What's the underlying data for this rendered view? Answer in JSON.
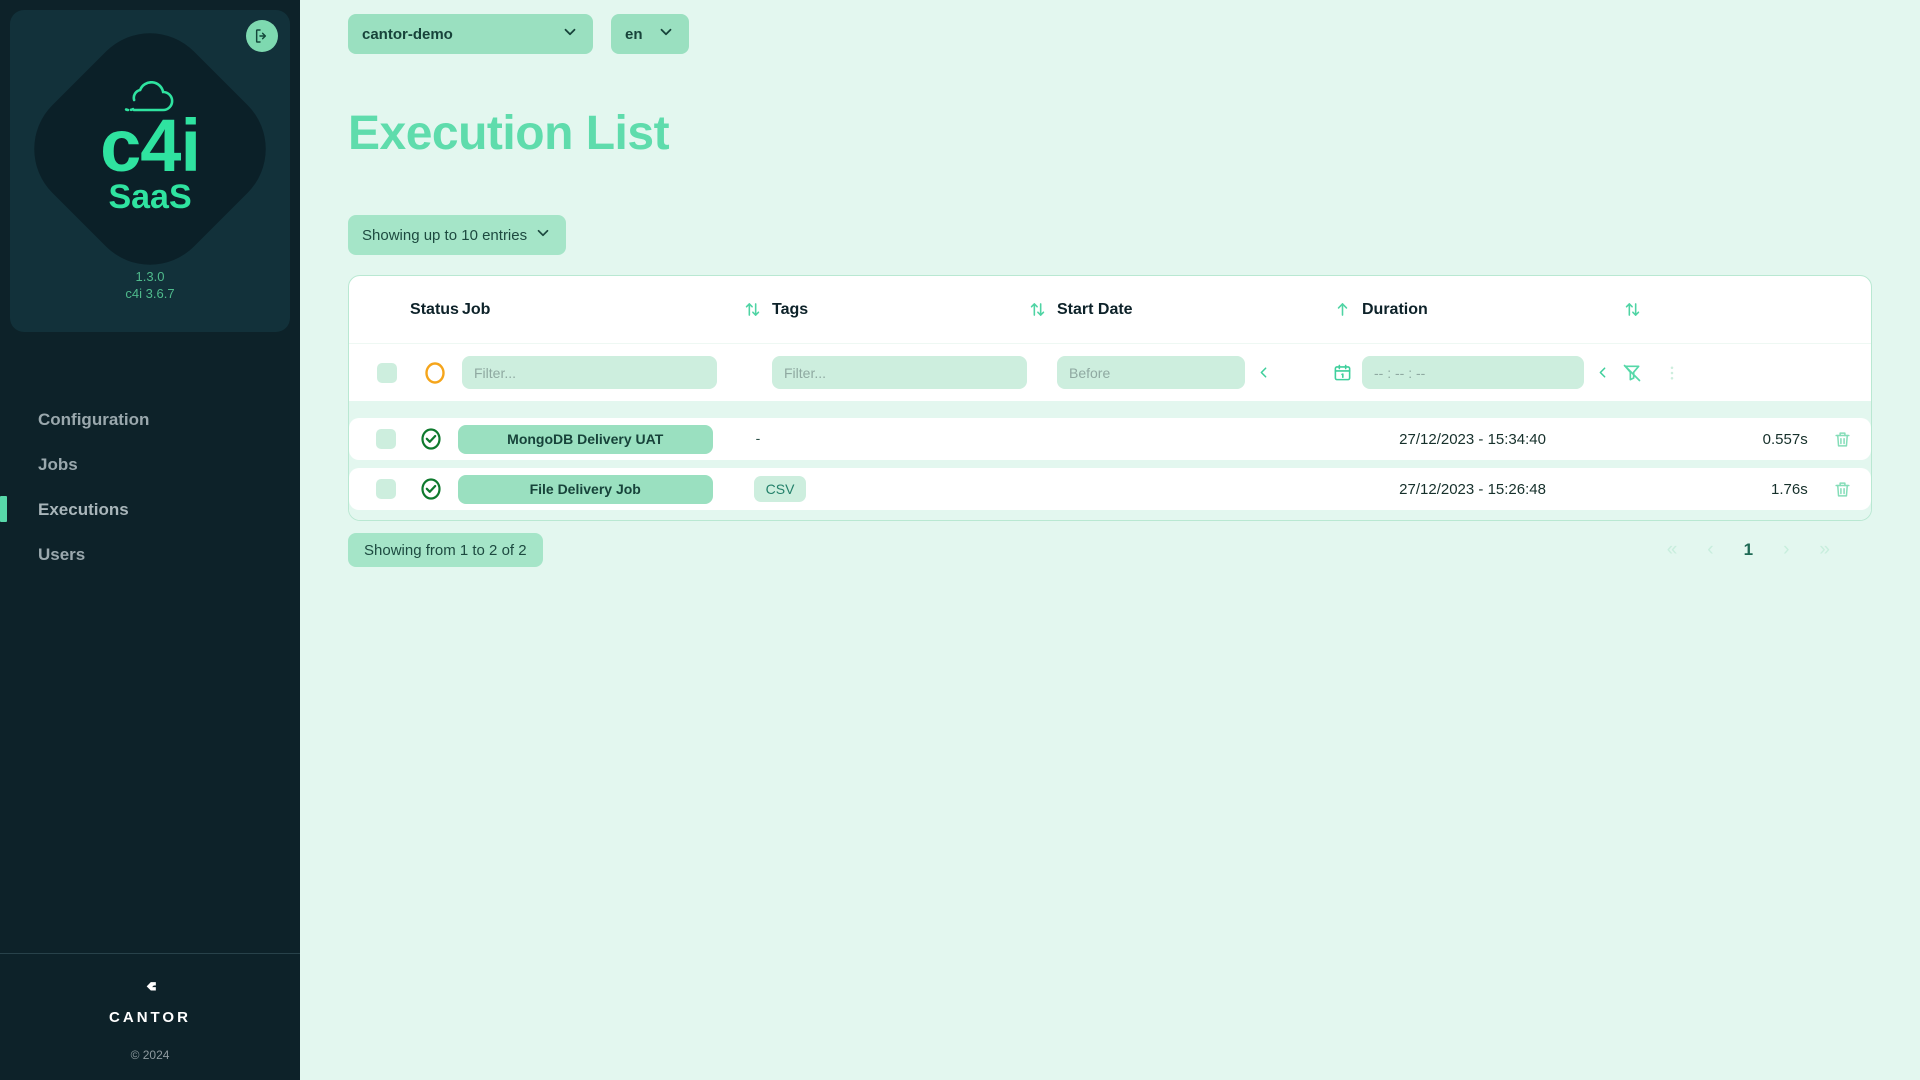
{
  "sidebar": {
    "logo": {
      "c4i": "c4i",
      "saas": "SaaS",
      "logout_icon": "logout-icon"
    },
    "version": {
      "app": "1.3.0",
      "engine": "c4i 3.6.7"
    },
    "nav": [
      {
        "label": "Configuration",
        "active": false
      },
      {
        "label": "Jobs",
        "active": false
      },
      {
        "label": "Executions",
        "active": true
      },
      {
        "label": "Users",
        "active": false
      }
    ],
    "footer": {
      "brand": "CANTOR",
      "copyright": "© 2024"
    }
  },
  "topbar": {
    "project": "cantor-demo",
    "language": "en"
  },
  "page": {
    "title": "Execution List",
    "entries_label": "Showing up to 10 entries"
  },
  "table": {
    "headers": {
      "status": "Status",
      "job": "Job",
      "tags": "Tags",
      "start_date": "Start Date",
      "duration": "Duration"
    },
    "sort_state": {
      "job": "none",
      "tags": "none",
      "start_date": "asc",
      "duration": "none"
    },
    "filters": {
      "job_placeholder": "Filter...",
      "job_value": "",
      "tags_placeholder": "Filter...",
      "tags_value": "",
      "date_placeholder": "Before",
      "date_value": "",
      "time_placeholder": "-- : -- : --",
      "time_value": ""
    },
    "rows": [
      {
        "status": "success",
        "job": "MongoDB Delivery UAT",
        "tags": "-",
        "has_tag_pill": false,
        "start_date": "27/12/2023 - 15:34:40",
        "duration": "0.557s"
      },
      {
        "status": "success",
        "job": "File Delivery Job",
        "tags": "CSV",
        "has_tag_pill": true,
        "start_date": "27/12/2023 - 15:26:48",
        "duration": "1.76s"
      }
    ]
  },
  "footer": {
    "showing": "Showing from 1 to 2 of 2",
    "pagination": {
      "first": "«",
      "prev": "‹",
      "current": "1",
      "next": "›",
      "last": "»"
    }
  },
  "colors": {
    "sidebar_bg": "#0d2229",
    "accent_green": "#2fe3a0",
    "title_green": "#5fdcac",
    "main_bg": "#e3f7ef",
    "pill_green": "#9ae0c0",
    "status_pending": "#f5a51b",
    "status_success": "#0f7a2e"
  }
}
